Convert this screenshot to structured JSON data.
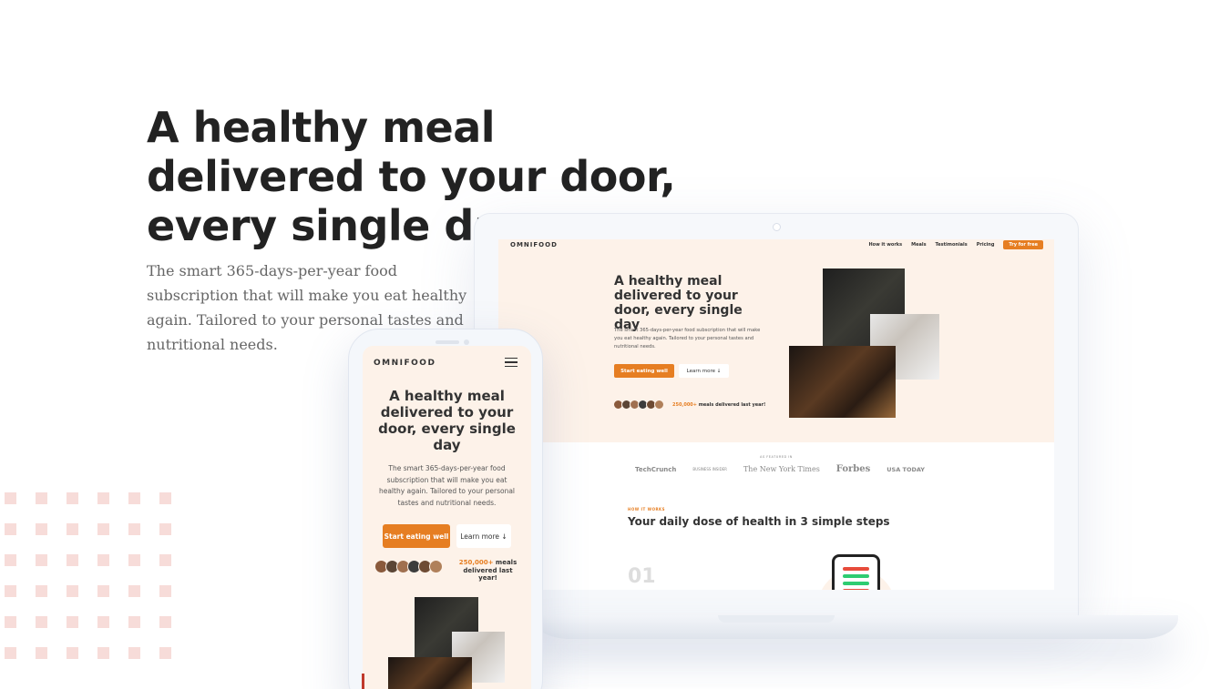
{
  "hero": {
    "title": "A healthy meal delivered to your door, every single day",
    "description": "The smart 365-days-per-year food subscription that will make you eat healthy again. Tailored to your personal tastes and nutritional needs."
  },
  "colors": {
    "accent": "#e67e22",
    "hero_bg": "#fdf2e9",
    "dots": "#f7dcd9"
  },
  "laptop": {
    "logo": "OMNIFOOD",
    "nav": [
      "How it works",
      "Meals",
      "Testimonials",
      "Pricing"
    ],
    "nav_cta": "Try for free",
    "title": "A healthy meal delivered to your door, every single day",
    "description": "The smart 365-days-per-year food subscription that will make you eat healthy again. Tailored to your personal tastes and nutritional needs.",
    "btn_primary": "Start eating well",
    "btn_secondary": "Learn more ↓",
    "meals_count": "250,000+",
    "meals_text": " meals delivered last year!",
    "featured_label": "AS FEATURED IN",
    "featured_logos": [
      "TechCrunch",
      "BUSINESS INSIDER",
      "The New York Times",
      "Forbes",
      "USA TODAY"
    ],
    "how_label": "HOW IT WORKS",
    "how_title": "Your daily dose of health in 3 simple steps",
    "step_number": "01"
  },
  "phone": {
    "logo": "OMNIFOOD",
    "title": "A healthy meal delivered to your door, every single day",
    "description": "The smart 365-days-per-year food subscription that will make you eat healthy again. Tailored to your personal tastes and nutritional needs.",
    "btn_primary": "Start eating well",
    "btn_secondary": "Learn more ↓",
    "meals_count": "250,000+",
    "meals_text": " meals delivered last year!"
  }
}
